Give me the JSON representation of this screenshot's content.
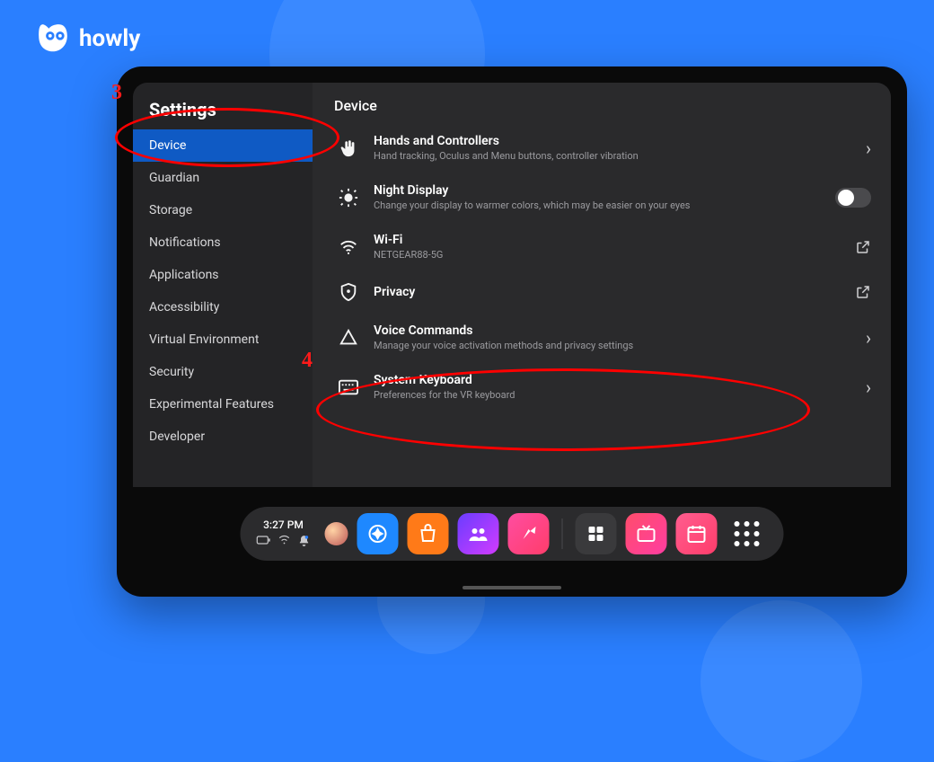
{
  "brand": {
    "name": "howly"
  },
  "annotations": {
    "step3": "3",
    "step4": "4"
  },
  "sidebar": {
    "title": "Settings",
    "items": [
      {
        "label": "Device",
        "active": true
      },
      {
        "label": "Guardian"
      },
      {
        "label": "Storage"
      },
      {
        "label": "Notifications"
      },
      {
        "label": "Applications"
      },
      {
        "label": "Accessibility"
      },
      {
        "label": "Virtual Environment"
      },
      {
        "label": "Security"
      },
      {
        "label": "Experimental Features"
      },
      {
        "label": "Developer"
      }
    ]
  },
  "content": {
    "title": "Device",
    "rows": [
      {
        "icon": "hands",
        "title": "Hands and Controllers",
        "sub": "Hand tracking, Oculus and Menu buttons, controller vibration",
        "action": "chevron"
      },
      {
        "icon": "brightness",
        "title": "Night Display",
        "sub": "Change your display to warmer colors, which may be easier on your eyes",
        "action": "toggle"
      },
      {
        "icon": "wifi",
        "title": "Wi-Fi",
        "sub": "NETGEAR88-5G",
        "action": "external"
      },
      {
        "icon": "shield",
        "title": "Privacy",
        "sub": "",
        "action": "external"
      },
      {
        "icon": "voice",
        "title": "Voice Commands",
        "sub": "Manage your voice activation methods and privacy settings",
        "action": "chevron"
      },
      {
        "icon": "keyboard",
        "title": "System Keyboard",
        "sub": "Preferences for the VR keyboard",
        "action": "chevron"
      }
    ]
  },
  "dock": {
    "time": "3:27 PM",
    "apps": [
      {
        "name": "explore",
        "color": "blue"
      },
      {
        "name": "store",
        "color": "orange"
      },
      {
        "name": "people",
        "color": "purple"
      },
      {
        "name": "share",
        "color": "pink1"
      },
      {
        "name": "spacer"
      },
      {
        "name": "library",
        "color": "gray"
      },
      {
        "name": "tv",
        "color": "pink2"
      },
      {
        "name": "events",
        "color": "pink3"
      },
      {
        "name": "all-apps",
        "color": "apps"
      }
    ]
  }
}
